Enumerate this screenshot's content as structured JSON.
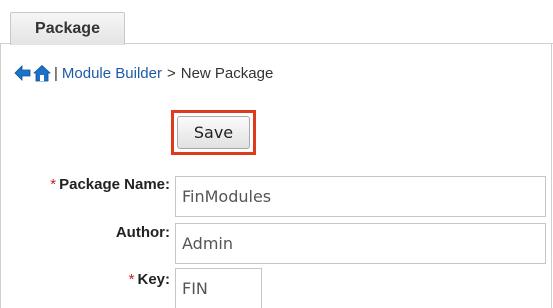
{
  "tabs": {
    "package_label": "Package"
  },
  "breadcrumb": {
    "separator": "|",
    "module_builder_link": "Module Builder",
    "arrow": ">",
    "current": "New Package",
    "back_icon": "back-arrow-icon",
    "home_icon": "home-icon"
  },
  "toolbar": {
    "save_label": "Save"
  },
  "form": {
    "required_marker": "*",
    "package_name": {
      "label": "Package Name:",
      "value": "FinModules",
      "required": true
    },
    "author": {
      "label": "Author:",
      "value": "Admin",
      "required": false
    },
    "key": {
      "label": "Key:",
      "value": "FIN",
      "required": true
    }
  },
  "colors": {
    "link": "#1f5aa6",
    "required": "#d21b1b",
    "highlight": "#e03a1e",
    "icon_blue": "#1a73c9"
  }
}
